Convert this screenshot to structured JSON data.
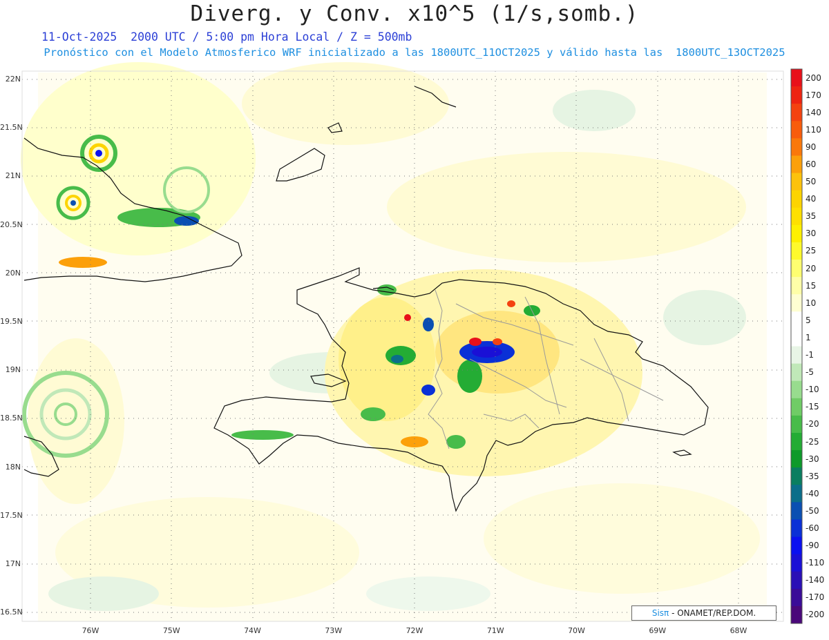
{
  "header": {
    "title": "Diverg. y Conv. x10^5 (1/s,somb.)",
    "valid_line": "11-Oct-2025  2000 UTC / 5:00 pm Hora Local / Z = 500mb",
    "model_line": "Pronóstico con el Modelo Atmosferico WRF inicializado a las 1800UTC_11OCT2025 y válido hasta las  1800UTC_13OCT2025"
  },
  "map": {
    "lat_labels": [
      "22N",
      "21.5N",
      "21N",
      "20.5N",
      "20N",
      "19.5N",
      "19N",
      "18.5N",
      "18N",
      "17.5N",
      "17N",
      "16.5N"
    ],
    "lon_labels": [
      "76W",
      "75W",
      "74W",
      "73W",
      "72W",
      "71W",
      "70W",
      "69W",
      "68W"
    ],
    "lat_range": [
      16.5,
      22.0
    ],
    "lon_range": [
      -76.8,
      -67.6
    ],
    "grid": "dotted"
  },
  "colorbar": {
    "labels": [
      "200",
      "170",
      "140",
      "110",
      "90",
      "60",
      "50",
      "40",
      "35",
      "30",
      "25",
      "20",
      "15",
      "10",
      "5",
      "1",
      "-1",
      "-5",
      "-10",
      "-15",
      "-20",
      "-25",
      "-30",
      "-35",
      "-40",
      "-50",
      "-60",
      "-90",
      "-110",
      "-140",
      "-170",
      "-200"
    ],
    "colors": [
      "#e8101a",
      "#ee2412",
      "#f44210",
      "#f85c0c",
      "#fa780a",
      "#fca00a",
      "#fdc20c",
      "#fdd400",
      "#ffe000",
      "#fff000",
      "#fffa2c",
      "#ffff70",
      "#ffffa8",
      "#ffffd2",
      "#ffffff",
      "#ffffff",
      "#e8f5e6",
      "#c0e8b8",
      "#98dc8e",
      "#70cc66",
      "#48bc4a",
      "#24ac34",
      "#0e9a2a",
      "#0a7e60",
      "#0b6e8a",
      "#0b4fb2",
      "#0a30d6",
      "#0a10f0",
      "#1a10d6",
      "#2a10b6",
      "#3a0c98",
      "#4a087a"
    ]
  },
  "footer": {
    "brand": "Sisπ",
    "credit": " - ONAMET/REP.DOM."
  }
}
